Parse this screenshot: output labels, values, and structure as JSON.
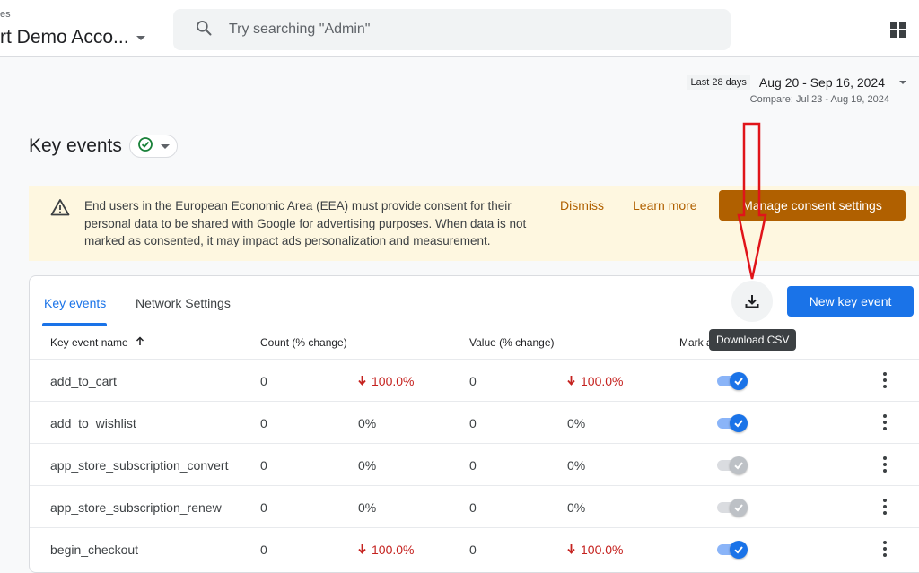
{
  "header": {
    "property_prefix": "es",
    "account_name": "rt Demo Acco...",
    "search_placeholder": "Try searching \"Admin\""
  },
  "date_range": {
    "preset": "Last 28 days",
    "range": "Aug 20 - Sep 16, 2024",
    "compare": "Compare: Jul 23 - Aug 19, 2024"
  },
  "page": {
    "title": "Key events"
  },
  "banner": {
    "text": "End users in the European Economic Area (EEA) must provide consent for their personal data to be shared with Google for advertising purposes. When data is not marked as consented, it may impact ads personalization and measurement.",
    "dismiss": "Dismiss",
    "learn_more": "Learn more",
    "manage": "Manage consent settings"
  },
  "tabs": [
    "Key events",
    "Network Settings"
  ],
  "actions": {
    "download_tooltip": "Download CSV",
    "new_key_event": "New key event"
  },
  "table": {
    "columns": {
      "name": "Key event name",
      "count": "Count (% change)",
      "value": "Value (% change)",
      "mark": "Mark a"
    },
    "rows": [
      {
        "name": "add_to_cart",
        "count": "0",
        "count_change": "100.0%",
        "count_down": true,
        "value": "0",
        "value_change": "100.0%",
        "value_down": true,
        "enabled": true
      },
      {
        "name": "add_to_wishlist",
        "count": "0",
        "count_change": "0%",
        "count_down": false,
        "value": "0",
        "value_change": "0%",
        "value_down": false,
        "enabled": true
      },
      {
        "name": "app_store_subscription_convert",
        "count": "0",
        "count_change": "0%",
        "count_down": false,
        "value": "0",
        "value_change": "0%",
        "value_down": false,
        "enabled": false
      },
      {
        "name": "app_store_subscription_renew",
        "count": "0",
        "count_change": "0%",
        "count_down": false,
        "value": "0",
        "value_change": "0%",
        "value_down": false,
        "enabled": false
      },
      {
        "name": "begin_checkout",
        "count": "0",
        "count_change": "100.0%",
        "count_down": true,
        "value": "0",
        "value_change": "100.0%",
        "value_down": true,
        "enabled": true
      }
    ]
  },
  "colors": {
    "accent": "#1a73e8",
    "warning_bg": "#fef7e0",
    "warning_accent": "#b06000",
    "decrease": "#c5221f",
    "annotation": "#e0141a"
  }
}
